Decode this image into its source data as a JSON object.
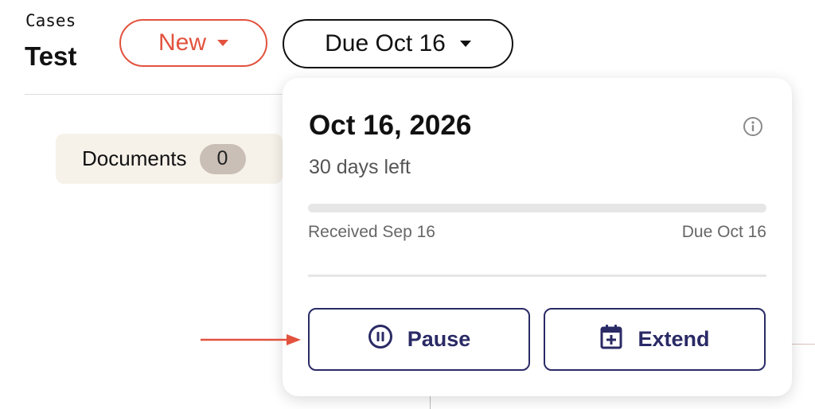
{
  "header": {
    "breadcrumb": "Cases",
    "title": "Test",
    "status_label": "New",
    "due_label": "Due Oct 16"
  },
  "tabs": [
    {
      "label": "Documents",
      "count": "0"
    }
  ],
  "popover": {
    "date": "Oct 16, 2026",
    "days_left": "30 days left",
    "progress_fraction": 0,
    "received_label": "Received Sep 16",
    "due_label": "Due Oct 16",
    "pause_label": "Pause",
    "extend_label": "Extend"
  },
  "colors": {
    "status_accent": "#e2523e",
    "action_accent": "#2a2a66",
    "annotation_arrow": "#e2523e"
  },
  "icons": [
    "info-icon",
    "pause-circle-icon",
    "calendar-plus-icon",
    "caret-down-icon"
  ]
}
